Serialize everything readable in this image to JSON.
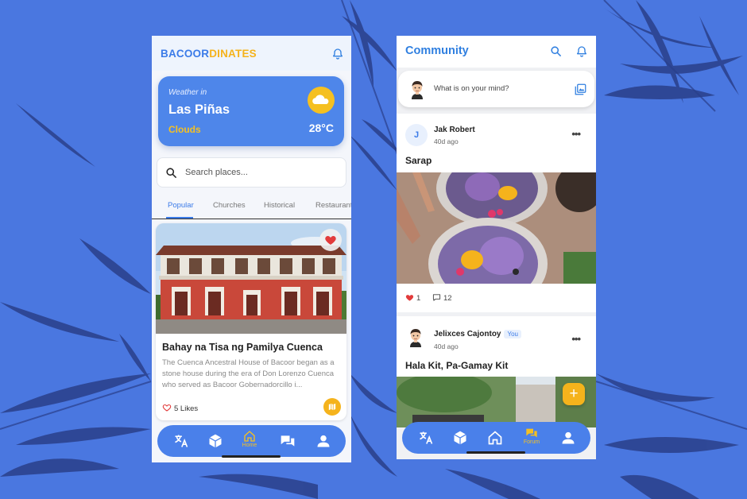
{
  "phone_home": {
    "brand": {
      "part1": "BACOOR",
      "part2": "DINATES"
    },
    "weather": {
      "prefix": "Weather in",
      "city": "Las Piñas",
      "condition": "Clouds",
      "temperature": "28°C"
    },
    "search": {
      "placeholder": "Search places..."
    },
    "tabs": [
      {
        "label": "Popular",
        "active": true
      },
      {
        "label": "Churches",
        "active": false
      },
      {
        "label": "Historical",
        "active": false
      },
      {
        "label": "Restaurants",
        "active": false
      }
    ],
    "place": {
      "title": "Bahay na Tisa ng Pamilya Cuenca",
      "description": "The Cuenca Ancestral House of Bacoor began as a stone house during the era of Don Lorenzo Cuenca who served as Bacoor Gobernadorcillo i...",
      "likes": "5 Likes",
      "favorited": true
    },
    "nav": {
      "items": [
        "translate-icon",
        "cube-icon",
        "home-icon",
        "forum-icon",
        "profile-icon"
      ],
      "active_label": "Home"
    }
  },
  "phone_community": {
    "title": "Community",
    "compose_placeholder": "What is on your mind?",
    "posts": [
      {
        "initial": "J",
        "author": "Jak Robert",
        "time": "40d ago",
        "title": "Sarap",
        "likes": "1",
        "comments": "12"
      },
      {
        "author": "Jelixces Cajontoy",
        "badge": "You",
        "time": "40d ago",
        "title": "Hala Kit, Pa-Gamay Kit"
      }
    ],
    "fab_label": "+",
    "nav": {
      "items": [
        "translate-icon",
        "cube-icon",
        "home-icon",
        "forum-icon",
        "profile-icon"
      ],
      "active_label": "Forum"
    }
  },
  "colors": {
    "background": "#4a77e0",
    "primary": "#3b7be8",
    "accent": "#f5b31c",
    "nav": "#4a80ea",
    "heart": "#e23b3b"
  }
}
